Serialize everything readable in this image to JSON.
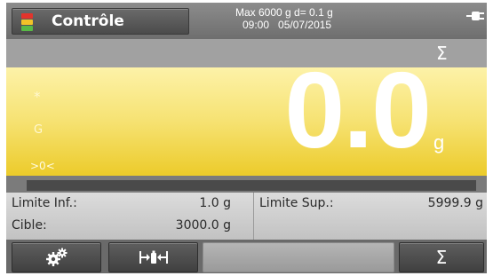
{
  "header": {
    "mode_label": "Contrôle",
    "capacity": "Max 6000 g  d= 0.1 g",
    "time": "09:00",
    "date": "05/07/2015",
    "mode_icon": "traffic-light-icon",
    "power_icon": "plug-icon"
  },
  "sigma_strip": {
    "sigma_label": "Σ"
  },
  "display": {
    "stable_indicator": "*",
    "gross_indicator": "G",
    "zero_indicator": ">0<",
    "weight": "0.0",
    "unit": "g"
  },
  "progress": {
    "fill_fraction": 0.0
  },
  "limits": {
    "lower_label": "Limite Inf.:",
    "lower_value": "1.0 g",
    "target_label": "Cible:",
    "target_value": "3000.0 g",
    "upper_label": "Limite Sup.:",
    "upper_value": "5999.9 g"
  },
  "buttons": {
    "settings_icon": "gears-icon",
    "tare_icon": "tare-icon",
    "sigma_label": "Σ"
  },
  "colors": {
    "display_yellow": "#f6e272",
    "bar_accent": "#f1cf3a"
  }
}
